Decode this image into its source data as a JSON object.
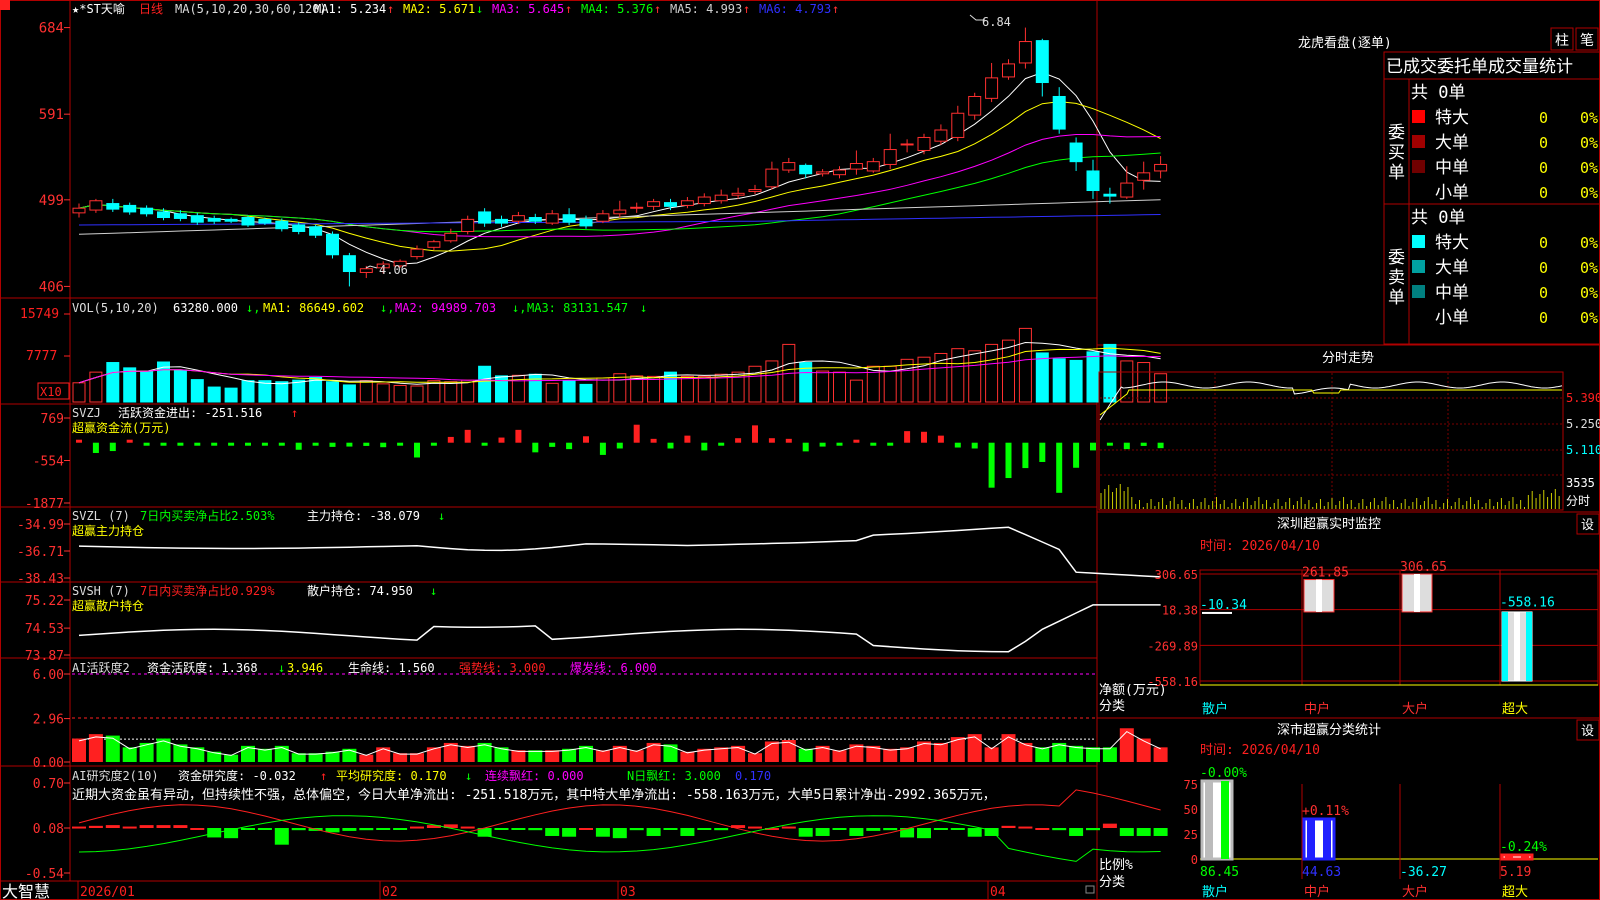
{
  "colors": {
    "up": "#ff3030",
    "down": "#00ffff",
    "border": "#b00000",
    "grid": "#7a0000",
    "ma1": "#ffffff",
    "ma2": "#ffff00",
    "ma3": "#ff00ff",
    "ma4": "#00ff00",
    "ma5": "#d0d0d0",
    "ma6": "#3030ff",
    "green": "#00ff00",
    "red": "#ff2020",
    "yellow": "#ffff00",
    "white": "#ffffff",
    "magenta": "#ff00ff",
    "label": "#e03030"
  },
  "main": {
    "title": "★*ST天喻",
    "period": "日线",
    "ma_spec": "MA(5,10,20,30,60,120)",
    "ma_items": [
      {
        "label": "MA1: 5.234",
        "arrow": "↑",
        "color": "#ffffff"
      },
      {
        "label": "MA2: 5.671",
        "arrow": "↓",
        "color": "#ffff00"
      },
      {
        "label": "MA3: 5.645",
        "arrow": "↑",
        "color": "#ff00ff"
      },
      {
        "label": "MA4: 5.376",
        "arrow": "↑",
        "color": "#00ff00"
      },
      {
        "label": "MA5: 4.993",
        "arrow": "↑",
        "color": "#d0d0d0"
      },
      {
        "label": "MA6: 4.793",
        "arrow": "↑",
        "color": "#3030ff"
      }
    ],
    "yticks": [
      "684",
      "591",
      "499",
      "406"
    ],
    "high_label": "6.84",
    "low_label": "4.06"
  },
  "vol": {
    "spec": "VOL(5,10,20)",
    "value": "63280.000",
    "ma1": "MA1: 86649.602",
    "ma2": "MA2: 94989.703",
    "ma3": "MA3: 83131.547",
    "yticks": [
      "15749",
      "7777"
    ],
    "unit": "X10"
  },
  "svzj": {
    "spec": "SVZJ",
    "label": "活跃资金进出: -251.516",
    "arrow": "↑",
    "sub": "超赢资金流(万元)",
    "yticks": [
      "769",
      "-554",
      "-1877"
    ]
  },
  "svzl": {
    "spec": "SVZL (7)",
    "desc": "7日内买卖净占比2.503%",
    "label": "主力持仓: -38.079",
    "arrow": "↓",
    "sub": "超赢主力持仓",
    "yticks": [
      "-34.99",
      "-36.71",
      "-38.43"
    ]
  },
  "svsh": {
    "spec": "SVSH (7)",
    "desc": "7日内买卖净占比0.929%",
    "label": "散户持仓: 74.950",
    "arrow": "↓",
    "sub": "超赢散户持仓",
    "yticks": [
      "75.22",
      "74.53",
      "73.87"
    ]
  },
  "ai1": {
    "spec": "AI活跃度2",
    "label1": "资金活跃度: 1.368",
    "arrow1": "↓",
    "label2": "3.946",
    "label3": "生命线: 1.560",
    "label4": "强势线: 3.000",
    "label5": "爆发线: 6.000",
    "yticks": [
      "6.00",
      "2.96",
      "0.00"
    ]
  },
  "ai2": {
    "spec": "AI研究度2(10)",
    "label1": "资金研究度: -0.032",
    "arrow1": "↑",
    "label2": "平均研究度: 0.170",
    "arrow2": "↓",
    "label3": "连续飘红: 0.000",
    "label4": "N日飘红: 3.000",
    "label5": "0.170",
    "yticks": [
      "0.70",
      "0.08",
      "-0.54"
    ],
    "comment": "近期大资金虽有异动，但持续性不强，总体偏空，今日大单净流出: -251.518万元，其中特大单净流出: -558.163万元，大单5日累计净出-2992.365万元，"
  },
  "xaxis": {
    "brand": "大智慧",
    "labels": [
      "2026/01",
      "02",
      "03",
      "04"
    ]
  },
  "lhb": {
    "title": "龙虎看盘(逐单)",
    "btn1": "柱",
    "btn2": "笔",
    "header": "已成交委托单成交量统计",
    "buy": {
      "side": "委买单",
      "total": "共 0单",
      "rows": [
        {
          "name": "特大",
          "count": "0",
          "pct": "0%",
          "color": "#ff0000"
        },
        {
          "name": "大单",
          "count": "0",
          "pct": "0%",
          "color": "#a00000"
        },
        {
          "name": "中单",
          "count": "0",
          "pct": "0%",
          "color": "#700000"
        },
        {
          "name": "小单",
          "count": "0",
          "pct": "0%",
          "color": ""
        }
      ]
    },
    "sell": {
      "side": "委卖单",
      "total": "共 0单",
      "rows": [
        {
          "name": "特大",
          "count": "0",
          "pct": "0%",
          "color": "#00ffff"
        },
        {
          "name": "大单",
          "count": "0",
          "pct": "0%",
          "color": "#00a0a0"
        },
        {
          "name": "中单",
          "count": "0",
          "pct": "0%",
          "color": "#008080"
        },
        {
          "name": "小单",
          "count": "0",
          "pct": "0%",
          "color": ""
        }
      ]
    }
  },
  "intraday": {
    "title": "分时走势",
    "yticks": [
      "5.390",
      "5.250",
      "5.110"
    ],
    "vol_tick": "3535",
    "vol_label": "分时"
  },
  "monitor": {
    "title": "深圳超赢实时监控",
    "btn": "设",
    "time": "时间: 2026/04/10",
    "yticks": [
      "306.65",
      "18.38",
      "-269.89",
      "-558.16"
    ],
    "ylabel": "净额(万元)",
    "xlabel": "分类",
    "categories": [
      "散户",
      "中户",
      "大户",
      "超大"
    ],
    "values": [
      -10.34,
      261.85,
      306.65,
      -558.16
    ],
    "value_labels": [
      "-10.34",
      "261.85",
      "306.65",
      "-558.16"
    ]
  },
  "classify": {
    "title": "深市超赢分类统计",
    "btn": "设",
    "time": "时间: 2026/04/10",
    "yticks": [
      "75",
      "50",
      "25",
      "0"
    ],
    "ylabel": "比例%",
    "xlabel": "分类",
    "categories": [
      "散户",
      "中户",
      "大户",
      "超大"
    ],
    "values": [
      86.45,
      44.63,
      -36.27,
      5.19
    ],
    "value_labels": [
      "86.45",
      "44.63",
      "-36.27",
      "5.19"
    ],
    "change_labels": [
      "-0.00%",
      "+0.11%",
      "",
      "-0.24%"
    ]
  },
  "chart_data": [
    {
      "type": "candlestick",
      "title": "★*ST天喻 日线",
      "ylim": [
        4.0,
        6.9
      ],
      "x": [
        "2026/01",
        "",
        "",
        "",
        "",
        "",
        "",
        "",
        "",
        "",
        "",
        "",
        "",
        "",
        "",
        "",
        "",
        "",
        "",
        "",
        "02",
        "",
        "",
        "",
        "",
        "",
        "",
        "",
        "",
        "",
        "",
        "",
        "",
        "",
        "03",
        "",
        "",
        "",
        "",
        "",
        "",
        "",
        "",
        "",
        "",
        "",
        "",
        "",
        "",
        "",
        "",
        "",
        "",
        "",
        "",
        "",
        "",
        "",
        "",
        "",
        "",
        "04",
        "",
        "",
        "",
        "",
        "",
        "",
        "",
        ""
      ],
      "open": [
        4.85,
        4.88,
        4.95,
        4.93,
        4.9,
        4.86,
        4.84,
        4.82,
        4.79,
        4.78,
        4.8,
        4.78,
        4.76,
        4.72,
        4.7,
        4.62,
        4.39,
        4.21,
        4.26,
        4.28,
        4.38,
        4.48,
        4.55,
        4.65,
        4.86,
        4.78,
        4.76,
        4.8,
        4.74,
        4.83,
        4.78,
        4.76,
        4.84,
        4.9,
        4.92,
        4.96,
        4.93,
        4.95,
        4.98,
        5.04,
        5.08,
        5.13,
        5.31,
        5.36,
        5.27,
        5.26,
        5.32,
        5.3,
        5.37,
        5.58,
        5.52,
        5.62,
        5.66,
        5.9,
        6.08,
        6.31,
        6.46,
        6.7,
        6.1,
        5.6,
        5.3,
        5.05,
        5.02,
        5.2,
        5.3
      ],
      "close": [
        4.9,
        4.98,
        4.89,
        4.86,
        4.84,
        4.8,
        4.79,
        4.75,
        4.76,
        4.76,
        4.72,
        4.74,
        4.68,
        4.65,
        4.61,
        4.4,
        4.22,
        4.25,
        4.3,
        4.33,
        4.46,
        4.54,
        4.63,
        4.78,
        4.74,
        4.74,
        4.82,
        4.76,
        4.84,
        4.75,
        4.71,
        4.84,
        4.88,
        4.91,
        4.97,
        4.92,
        4.98,
        5.02,
        5.04,
        5.06,
        5.1,
        5.32,
        5.39,
        5.27,
        5.29,
        5.31,
        5.38,
        5.4,
        5.53,
        5.59,
        5.66,
        5.74,
        5.92,
        6.1,
        6.3,
        6.45,
        6.69,
        6.25,
        5.75,
        5.4,
        5.09,
        5.03,
        5.17,
        5.28,
        5.37
      ],
      "high": [
        4.95,
        5.0,
        5.0,
        4.96,
        4.93,
        4.9,
        4.88,
        4.85,
        4.82,
        4.8,
        4.82,
        4.8,
        4.79,
        4.75,
        4.72,
        4.65,
        4.42,
        4.28,
        4.33,
        4.35,
        4.5,
        4.56,
        4.68,
        4.82,
        4.9,
        4.82,
        4.86,
        4.84,
        4.88,
        4.9,
        4.82,
        4.88,
        4.98,
        4.96,
        5.0,
        5.0,
        5.02,
        5.06,
        5.1,
        5.12,
        5.15,
        5.4,
        5.44,
        5.38,
        5.32,
        5.35,
        5.52,
        5.44,
        5.7,
        5.64,
        5.7,
        5.8,
        6.0,
        6.14,
        6.46,
        6.5,
        6.84,
        6.72,
        6.2,
        5.66,
        5.42,
        5.12,
        5.35,
        5.4,
        5.46
      ],
      "low": [
        4.8,
        4.85,
        4.86,
        4.83,
        4.81,
        4.77,
        4.76,
        4.72,
        4.73,
        4.74,
        4.7,
        4.72,
        4.65,
        4.62,
        4.58,
        4.36,
        4.06,
        4.15,
        4.2,
        4.26,
        4.35,
        4.45,
        4.53,
        4.62,
        4.7,
        4.7,
        4.73,
        4.73,
        4.72,
        4.72,
        4.68,
        4.74,
        4.8,
        4.85,
        4.88,
        4.88,
        4.9,
        4.92,
        4.95,
        5.0,
        5.05,
        5.1,
        5.28,
        5.22,
        5.24,
        5.22,
        5.26,
        5.28,
        5.32,
        5.5,
        5.48,
        5.58,
        5.62,
        5.85,
        6.04,
        6.28,
        6.4,
        6.1,
        5.7,
        5.3,
        5.0,
        4.95,
        5.0,
        5.1,
        5.22
      ]
    },
    {
      "type": "bar",
      "title": "VOL(5,10,20)",
      "ylabel": "X10",
      "values": [
        3.6,
        5.6,
        7.4,
        6.4,
        5.8,
        7.5,
        6.0,
        4.2,
        2.8,
        2.6,
        4.0,
        4.0,
        3.8,
        4.1,
        4.6,
        3.8,
        3.2,
        4.0,
        3.4,
        3.1,
        3.0,
        4.0,
        3.8,
        4.1,
        6.7,
        4.9,
        5.0,
        5.2,
        3.5,
        4.0,
        3.3,
        4.5,
        5.3,
        4.9,
        4.8,
        5.6,
        4.8,
        4.8,
        5.2,
        5.6,
        6.7,
        7.7,
        10.8,
        7.4,
        5.8,
        5.6,
        4.1,
        6.7,
        6.7,
        8.0,
        8.4,
        9.1,
        10.0,
        9.6,
        10.8,
        11.6,
        13.8,
        9.2,
        8.1,
        7.8,
        9.4,
        10.8,
        7.7,
        7.4,
        5.3
      ]
    },
    {
      "type": "bar",
      "title": "超赢资金流(万元)",
      "ylim": [
        -1877,
        769
      ],
      "values": [
        80,
        -320,
        -260,
        40,
        -20,
        -40,
        -30,
        -80,
        -60,
        -90,
        -70,
        -50,
        -30,
        -220,
        -40,
        -130,
        -120,
        -100,
        -140,
        -80,
        -460,
        -40,
        180,
        400,
        -80,
        160,
        400,
        -300,
        -130,
        -200,
        200,
        -380,
        -180,
        560,
        120,
        -180,
        220,
        -240,
        -40,
        140,
        540,
        140,
        120,
        -270,
        -120,
        -40,
        80,
        -40,
        -80,
        360,
        340,
        220,
        -150,
        -180,
        -1400,
        -1100,
        -790,
        -600,
        -1560,
        -780,
        -240,
        -60,
        -200,
        -100,
        -170
      ]
    },
    {
      "type": "line",
      "title": "超赢主力持仓",
      "ylim": [
        -38.43,
        -34.99
      ]
    },
    {
      "type": "line",
      "title": "超赢散户持仓",
      "ylim": [
        73.87,
        75.22
      ]
    },
    {
      "type": "bar",
      "title": "AI活跃度2",
      "ylim": [
        0,
        6
      ],
      "values": [
        1.6,
        1.9,
        1.8,
        1.0,
        1.3,
        1.6,
        1.2,
        1.0,
        0.7,
        0.5,
        1.1,
        0.9,
        1.1,
        0.6,
        0.6,
        0.7,
        0.9,
        0.5,
        1.0,
        0.6,
        0.6,
        1.0,
        1.3,
        1.1,
        1.3,
        1.0,
        0.8,
        0.8,
        0.8,
        0.9,
        1.1,
        0.8,
        1.1,
        0.8,
        1.3,
        1.2,
        0.7,
        0.9,
        1.0,
        1.1,
        0.6,
        1.4,
        1.5,
        0.9,
        1.1,
        0.8,
        1.2,
        1.1,
        0.9,
        1.0,
        1.4,
        1.3,
        1.7,
        1.9,
        1.0,
        1.9,
        1.3,
        1.0,
        1.3,
        1.1,
        1.0,
        1.0,
        2.3,
        1.6,
        1.0
      ]
    },
    {
      "type": "bar",
      "title": "AI研究度2(10)",
      "ylim": [
        -0.54,
        0.7
      ],
      "values": [
        0.1,
        0.11,
        0.12,
        0.1,
        0.12,
        0.12,
        0.12,
        0.08,
        -0.05,
        -0.06,
        0.07,
        0.06,
        -0.15,
        0.05,
        0.04,
        0.02,
        0.04,
        0.05,
        0.06,
        0.07,
        0.1,
        0.12,
        0.13,
        0.1,
        -0.04,
        0.06,
        0.07,
        0.05,
        -0.03,
        -0.04,
        0.08,
        -0.04,
        -0.06,
        0.05,
        -0.03,
        0.07,
        -0.03,
        0.06,
        0.05,
        0.12,
        0.1,
        0.08,
        0.1,
        -0.04,
        -0.03,
        0.06,
        -0.03,
        0.04,
        0.05,
        -0.05,
        -0.06,
        0.06,
        0.07,
        -0.04,
        -0.03,
        0.11,
        0.1,
        0.08,
        0.05,
        -0.03,
        0.05,
        0.14,
        -0.03,
        -0.03,
        -0.03
      ]
    },
    {
      "type": "bar",
      "title": "深圳超赢实时监控",
      "categories": [
        "散户",
        "中户",
        "大户",
        "超大"
      ],
      "values": [
        -10.34,
        261.85,
        306.65,
        -558.16
      ],
      "ylim": [
        -558.16,
        306.65
      ]
    },
    {
      "type": "bar",
      "title": "深市超赢分类统计",
      "categories": [
        "散户",
        "中户",
        "大户",
        "超大"
      ],
      "values": [
        86.45,
        44.63,
        -36.27,
        5.19
      ],
      "ylim": [
        0,
        75
      ]
    }
  ]
}
